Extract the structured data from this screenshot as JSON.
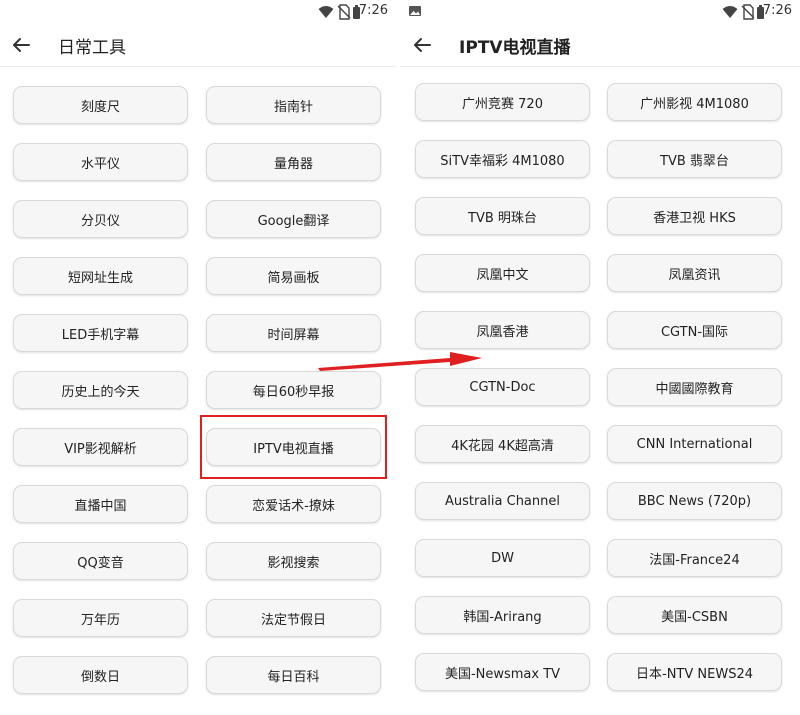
{
  "status_bar": {
    "time": "7:26"
  },
  "left_screen": {
    "title": "日常工具",
    "tools": [
      "刻度尺",
      "指南针",
      "水平仪",
      "量角器",
      "分贝仪",
      "Google翻译",
      "短网址生成",
      "简易画板",
      "LED手机字幕",
      "时间屏幕",
      "历史上的今天",
      "每日60秒早报",
      "VIP影视解析",
      "IPTV电视直播",
      "直播中国",
      "恋爱话术-撩妹",
      "QQ变音",
      "影视搜索",
      "万年历",
      "法定节假日",
      "倒数日",
      "每日百科"
    ],
    "highlighted_tool": "IPTV电视直播"
  },
  "right_screen": {
    "title": "IPTV电视直播",
    "channels": [
      "广州竞赛 720",
      "广州影视 4M1080",
      "SiTV幸福彩 4M1080",
      "TVB 翡翠台",
      "TVB 明珠台",
      "香港卫视 HKS",
      "凤凰中文",
      "凤凰资讯",
      "凤凰香港",
      "CGTN-国际",
      "CGTN-Doc",
      "中國國際教育",
      "4K花园 4K超高清",
      "CNN International",
      "Australia Channel",
      "BBC News (720p)",
      "DW",
      "法国-France24",
      "韩国-Arirang",
      "美国-CSBN",
      "美国-Newsmax TV",
      "日本-NTV NEWS24"
    ]
  },
  "annotation": {
    "highlight_color": "#e02020",
    "arrow_color": "#e02020"
  },
  "colors": {
    "button_bg": "#f6f6f6",
    "button_border": "#d9d9d9",
    "text": "#222222"
  }
}
